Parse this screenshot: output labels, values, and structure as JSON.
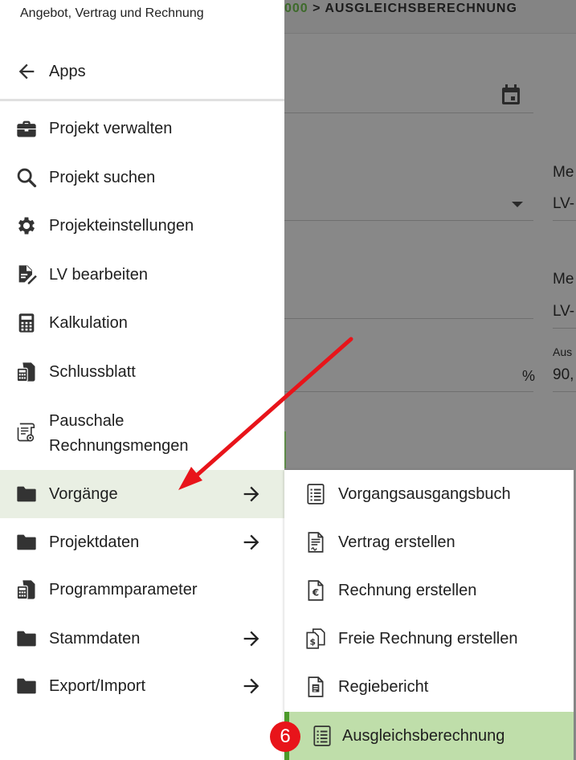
{
  "background": {
    "breadcrumb_prefix": "000",
    "breadcrumb_sep": " > ",
    "breadcrumb_page": "AUSGLEICHSBERECHNUNG",
    "label_me_1": "Me",
    "value_lv_1": "LV-",
    "label_me_2": "Me",
    "value_lv_2": "LV-",
    "label_aus": "Aus",
    "value_90": "90,",
    "percent": "%"
  },
  "drawer": {
    "title": "Angebot, Vertrag und Rechnung",
    "back_label": "Apps",
    "items": [
      {
        "label": "Projekt verwalten",
        "icon": "briefcase-icon"
      },
      {
        "label": "Projekt suchen",
        "icon": "search-icon"
      },
      {
        "label": "Projekteinstellungen",
        "icon": "gear-icon"
      },
      {
        "label": "LV bearbeiten",
        "icon": "edit-document-icon"
      },
      {
        "label": "Kalkulation",
        "icon": "calculator-icon"
      },
      {
        "label": "Schlussblatt",
        "icon": "sheet-calculator-icon"
      },
      {
        "label_line1": "Pauschale",
        "label_line2": "Rechnungsmengen",
        "icon": "scroll-document-icon"
      },
      {
        "label": "Vorgänge",
        "icon": "folder-icon",
        "has_submenu": true,
        "active": true
      },
      {
        "label": "Projektdaten",
        "icon": "folder-icon",
        "has_submenu": true
      },
      {
        "label": "Programmparameter",
        "icon": "sheet-calculator-icon"
      },
      {
        "label": "Stammdaten",
        "icon": "folder-icon",
        "has_submenu": true
      },
      {
        "label": "Export/Import",
        "icon": "folder-icon",
        "has_submenu": true
      }
    ]
  },
  "submenu": {
    "items": [
      {
        "label": "Vorgangsausgangsbuch",
        "icon": "list-document-icon"
      },
      {
        "label": "Vertrag erstellen",
        "icon": "contract-document-icon"
      },
      {
        "label": "Rechnung erstellen",
        "icon": "euro-document-icon"
      },
      {
        "label": "Freie Rechnung erstellen",
        "icon": "dollar-documents-icon"
      },
      {
        "label": "Regiebericht",
        "icon": "report-document-icon"
      },
      {
        "label": "Ausgleichsberechnung",
        "icon": "list-document-icon",
        "active": true
      }
    ]
  },
  "annotation": {
    "step_number": "6",
    "color": "#e8141a"
  },
  "colors": {
    "active_item_bg": "#e9efe3",
    "submenu_active_bg": "#bfdeaa",
    "submenu_active_border": "#4c9a2a",
    "breadcrumb_accent": "#3d6a2a"
  }
}
